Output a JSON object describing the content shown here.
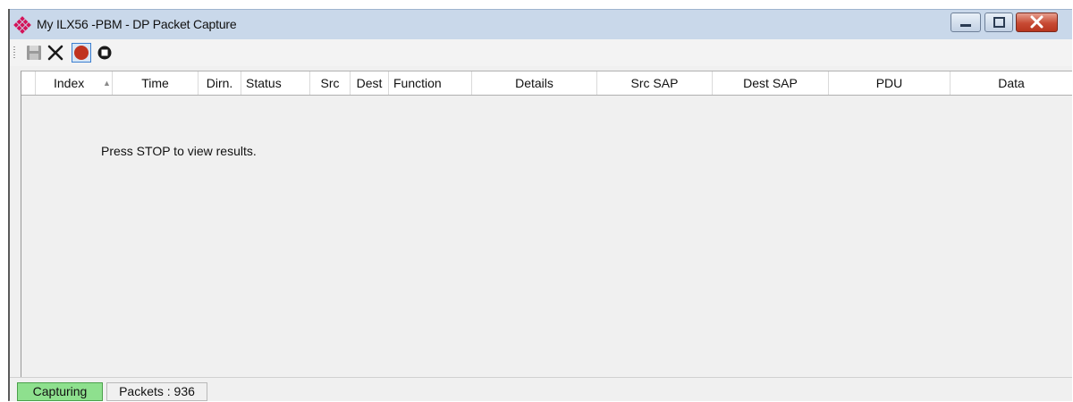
{
  "window": {
    "title": "My ILX56 -PBM - DP Packet Capture"
  },
  "toolbar": {
    "buttons": [
      {
        "name": "save",
        "icon": "save-icon",
        "enabled": false
      },
      {
        "name": "clear",
        "icon": "close-x-icon",
        "enabled": true
      },
      {
        "name": "record",
        "icon": "record-icon",
        "active": true
      },
      {
        "name": "stop",
        "icon": "stop-icon",
        "enabled": true
      }
    ]
  },
  "grid": {
    "columns": [
      "Index",
      "Time",
      "Dirn.",
      "Status",
      "Src",
      "Dest",
      "Function",
      "Details",
      "Src SAP",
      "Dest SAP",
      "PDU",
      "Data"
    ],
    "sort_column": "Index",
    "sort_direction": "ascending",
    "empty_message": "Press STOP to view results."
  },
  "statusbar": {
    "state": "Capturing",
    "packets": "Packets : 936"
  },
  "colors": {
    "titlebar": "#c9d8ea",
    "capturing_green": "#8ee08e",
    "record_red": "#c0331f",
    "close_button_red": "#c74a33",
    "app_icon": "#d4145a"
  }
}
